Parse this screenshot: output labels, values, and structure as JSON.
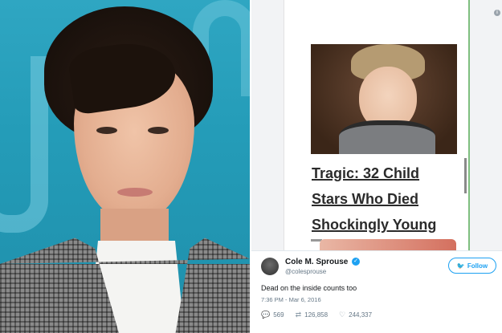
{
  "article": {
    "headline_lines": [
      "Tragic: 32 Child",
      "Stars Who Died",
      "Shockingly Young"
    ]
  },
  "tweet": {
    "display_name": "Cole M. Sprouse",
    "handle": "@colesprouse",
    "follow_label": "Follow",
    "text": "Dead on the inside counts too",
    "timestamp": "7:36 PM - Mar 6, 2016",
    "replies": "569",
    "retweets": "126,858",
    "likes": "244,337"
  },
  "icons": {
    "info": "info-icon",
    "verified": "verified-icon",
    "follow_bird": "twitter-bird-icon",
    "reply": "reply-icon",
    "retweet": "retweet-icon",
    "like": "heart-icon"
  },
  "colors": {
    "twitter_blue": "#1da1f2",
    "photo_backdrop": "#249cb8",
    "tweet_secondary_text": "#657786"
  }
}
